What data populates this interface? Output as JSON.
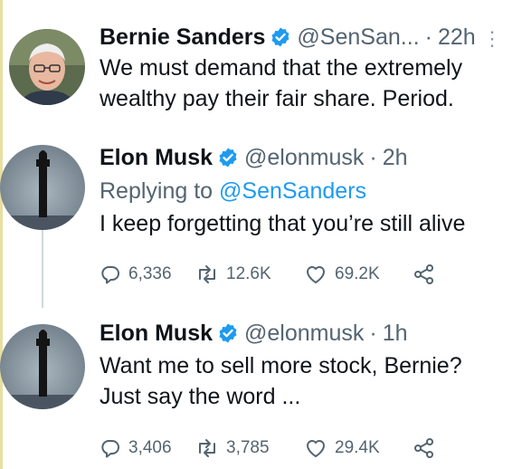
{
  "tweets": [
    {
      "name": "Bernie Sanders",
      "handle": "@SenSan...",
      "time": "22h",
      "text_lines": [
        "We must demand that the extremely",
        "wealthy pay their fair share. Period."
      ]
    },
    {
      "name": "Elon Musk",
      "handle": "@elonmusk",
      "time": "2h",
      "replying_prefix": "Replying to ",
      "replying_handle": "@SenSanders",
      "text_lines": [
        "I keep forgetting that you’re still alive"
      ],
      "stats": {
        "replies": "6,336",
        "retweets": "12.6K",
        "likes": "69.2K"
      }
    },
    {
      "name": "Elon Musk",
      "handle": "@elonmusk",
      "time": "1h",
      "text_lines": [
        "Want me to sell more stock, Bernie?",
        "Just say the word ..."
      ],
      "stats": {
        "replies": "3,406",
        "retweets": "3,785",
        "likes": "29.4K"
      }
    }
  ],
  "separator": "·",
  "more_glyph": "⋮",
  "icons": {
    "verified": "verified-badge-icon",
    "reply": "reply-icon",
    "retweet": "retweet-icon",
    "like": "heart-icon",
    "share": "share-icon",
    "more": "more-options-icon"
  },
  "colors": {
    "verified": "#1d9bf0",
    "text": "#0f1419",
    "muted": "#536471",
    "link": "#1d9bf0"
  }
}
